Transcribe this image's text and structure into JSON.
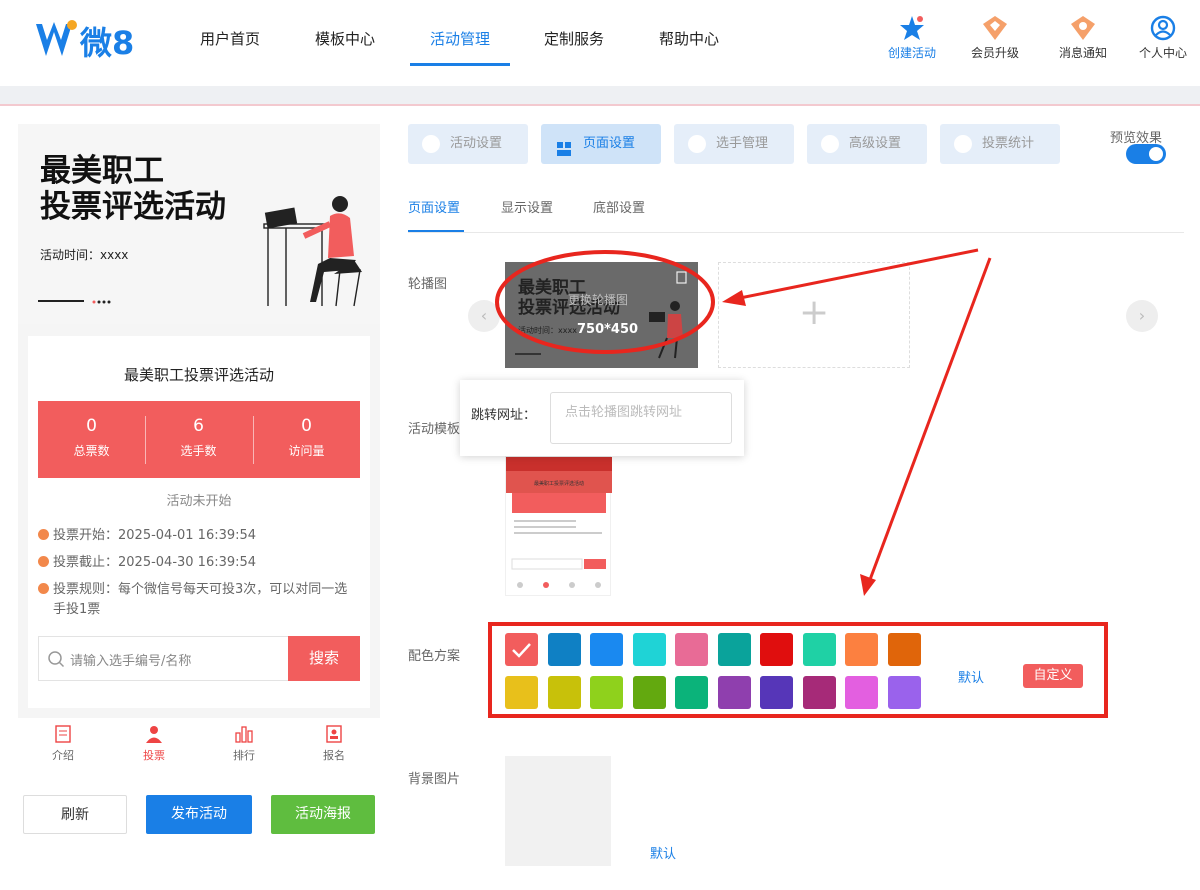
{
  "header": {
    "logo_text": "微8",
    "nav": [
      "用户首页",
      "模板中心",
      "活动管理",
      "定制服务",
      "帮助中心"
    ],
    "active_nav": "活动管理",
    "actions": [
      {
        "label": "创建活动",
        "icon": "star-icon"
      },
      {
        "label": "会员升级",
        "icon": "crown-badge-icon"
      },
      {
        "label": "消息通知",
        "icon": "bell-badge-icon"
      },
      {
        "label": "个人中心",
        "icon": "user-circle-icon"
      }
    ],
    "accent": "#1a7fe6"
  },
  "preview": {
    "banner_title": "最美职工\n投票评选活动",
    "banner_time": "活动时间：xxxx",
    "card_title": "最美职工投票评选活动",
    "stats": [
      {
        "value": "0",
        "label": "总票数"
      },
      {
        "value": "6",
        "label": "选手数"
      },
      {
        "value": "0",
        "label": "访问量"
      }
    ],
    "status": "活动未开始",
    "info": [
      "投票开始：2025-04-01 16:39:54",
      "投票截止：2025-04-30 16:39:54",
      "投票规则：每个微信号每天可投3次，可以对同一选手投1票"
    ],
    "search_placeholder": "请输入选手编号/名称",
    "search_button": "搜索",
    "tabs": [
      "介绍",
      "投票",
      "排行",
      "报名"
    ],
    "active_tab": "投票",
    "buttons": {
      "refresh": "刷新",
      "publish": "发布活动",
      "poster": "活动海报"
    },
    "theme_color": "#f25d5d"
  },
  "settings": {
    "main_tabs": [
      "活动设置",
      "页面设置",
      "选手管理",
      "高级设置",
      "投票统计"
    ],
    "active_main_tab": "页面设置",
    "preview_label": "预览效果",
    "preview_on": true,
    "sub_tabs": [
      "页面设置",
      "显示设置",
      "底部设置"
    ],
    "active_sub_tab": "页面设置",
    "carousel_label": "轮播图",
    "carousel_thumb_title": "最美职工\n投票评选活动",
    "carousel_thumb_time": "活动时间：xxxx",
    "carousel_replace_text": "更换轮播图",
    "carousel_size": "750*450",
    "add_symbol": "+",
    "jump_label": "跳转网址：",
    "jump_placeholder": "点击轮播图跳转网址",
    "template_label": "活动模板",
    "template_preview_title": "最美职工投票评选活动",
    "scheme_label": "配色方案",
    "swatches": [
      "#f25d5d",
      "#0f80c4",
      "#1a89f0",
      "#1fd3d6",
      "#e86b96",
      "#0aa39b",
      "#e00e0e",
      "#1fd1a5",
      "#fc8040",
      "#e0650a",
      "#e8c01b",
      "#c8c10a",
      "#8fd11c",
      "#63a90f",
      "#0bb37a",
      "#8f3fae",
      "#5636b8",
      "#a62a78",
      "#e35fe0",
      "#9a62ec"
    ],
    "selected_swatch": 0,
    "scheme_default": "默认",
    "scheme_custom": "自定义",
    "bg_label": "背景图片",
    "bg_default": "默认"
  }
}
